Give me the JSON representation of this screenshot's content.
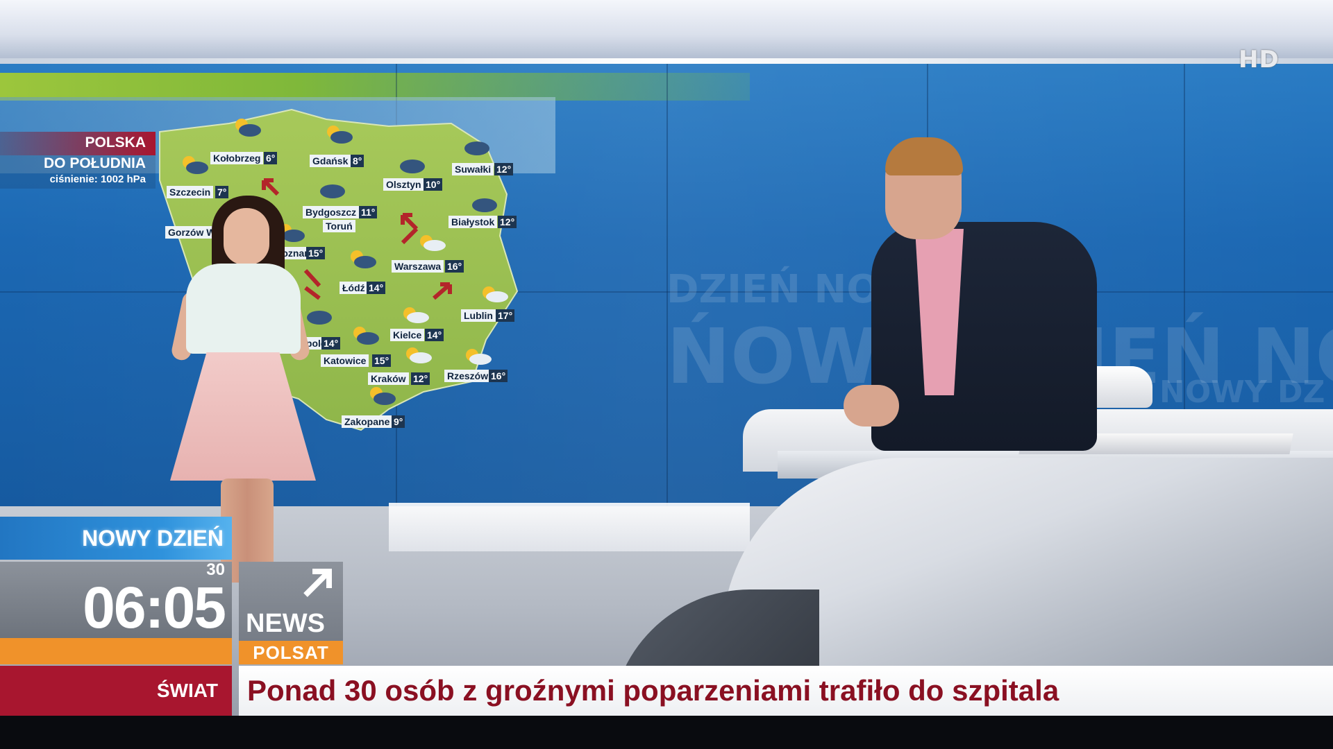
{
  "broadcast": {
    "hd_badge": "HD",
    "wall_watermark_1": "DZIEŃ NOWY D",
    "wall_watermark_2": "ŃOWY DZIEŃ NO",
    "wall_watermark_3": "NOWY DZ"
  },
  "weather_map": {
    "region_title": "POLSKA",
    "forecast_period": "DO POŁUDNIA",
    "pressure": "ciśnienie: 1002 hPa",
    "cities": [
      {
        "name": "Kołobrzeg",
        "temp": "6°"
      },
      {
        "name": "Gdańsk",
        "temp": "8°"
      },
      {
        "name": "Suwałki",
        "temp": "12°"
      },
      {
        "name": "Szczecin",
        "temp": "7°"
      },
      {
        "name": "Olsztyn",
        "temp": "10°"
      },
      {
        "name": "Bydgoszcz",
        "temp": "11°"
      },
      {
        "name": "Toruń",
        "temp": ""
      },
      {
        "name": "Białystok",
        "temp": "12°"
      },
      {
        "name": "Gorzów W",
        "temp": ""
      },
      {
        "name": "Poznań",
        "temp": "15°"
      },
      {
        "name": "Warszawa",
        "temp": "16°"
      },
      {
        "name": "Łódź",
        "temp": "14°"
      },
      {
        "name": "Lublin",
        "temp": "17°"
      },
      {
        "name": "Opole",
        "temp": "14°"
      },
      {
        "name": "Kielce",
        "temp": "14°"
      },
      {
        "name": "Katowice",
        "temp": "15°"
      },
      {
        "name": "Kraków",
        "temp": "12°"
      },
      {
        "name": "Rzeszów",
        "temp": "16°"
      },
      {
        "name": "Zakopane",
        "temp": "9°"
      }
    ]
  },
  "lower_third": {
    "show_name": "NOWY DZIEŃ",
    "clock_time": "06:05",
    "clock_seconds": "30",
    "channel_name": "NEWS",
    "channel_brand": "POLSAT",
    "category": "ŚWIAT",
    "headline": "Ponad 30 osób z groźnymi poparzeniami trafiło do szpitala"
  },
  "colors": {
    "accent_orange": "#f0922a",
    "category_red": "#a8162f",
    "headline_red": "#8a1022",
    "show_blue": "#2f92dc"
  }
}
